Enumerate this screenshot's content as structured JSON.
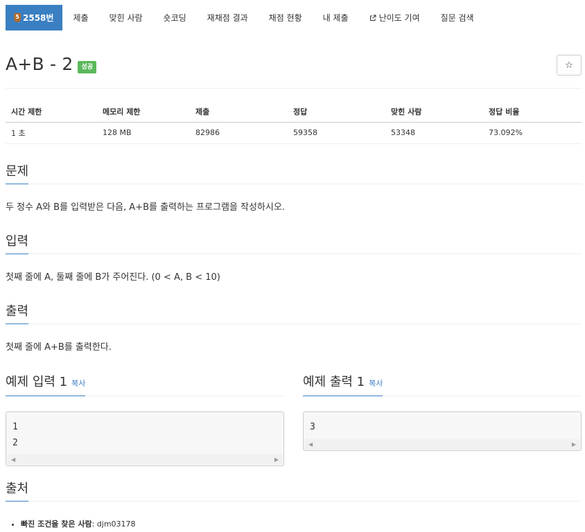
{
  "nav": {
    "problem_number": "2558번",
    "badge_level": "5",
    "items": [
      "제출",
      "맞힌 사람",
      "숏코딩",
      "재채점 결과",
      "채점 현황",
      "내 제출",
      "난이도 기여",
      "질문 검색"
    ]
  },
  "problem": {
    "title": "A+B - 2",
    "status": "성공",
    "star_icon": "☆"
  },
  "info_table": {
    "headers": [
      "시간 제한",
      "메모리 제한",
      "제출",
      "정답",
      "맞힌 사람",
      "정답 비율"
    ],
    "values": [
      "1 초",
      "128 MB",
      "82986",
      "59358",
      "53348",
      "73.092%"
    ]
  },
  "sections": {
    "description": {
      "heading": "문제",
      "text": "두 정수 A와 B를 입력받은 다음, A+B를 출력하는 프로그램을 작성하시오."
    },
    "input": {
      "heading": "입력",
      "text": "첫째 줄에 A, 둘째 줄에 B가 주어진다. (0 < A, B < 10)"
    },
    "output": {
      "heading": "출력",
      "text": "첫째 줄에 A+B를 출력한다."
    },
    "sample_input": {
      "heading": "예제 입력 1",
      "copy": "복사",
      "code": "1\n2"
    },
    "sample_output": {
      "heading": "예제 출력 1",
      "copy": "복사",
      "code": "3"
    },
    "source": {
      "heading": "출처",
      "label": "빠진 조건을 찾은 사람",
      "value": ": djm03178"
    }
  },
  "colors": {
    "accent": "#3a7fc1",
    "success": "#5cb85c",
    "badge": "#b06a2c"
  }
}
